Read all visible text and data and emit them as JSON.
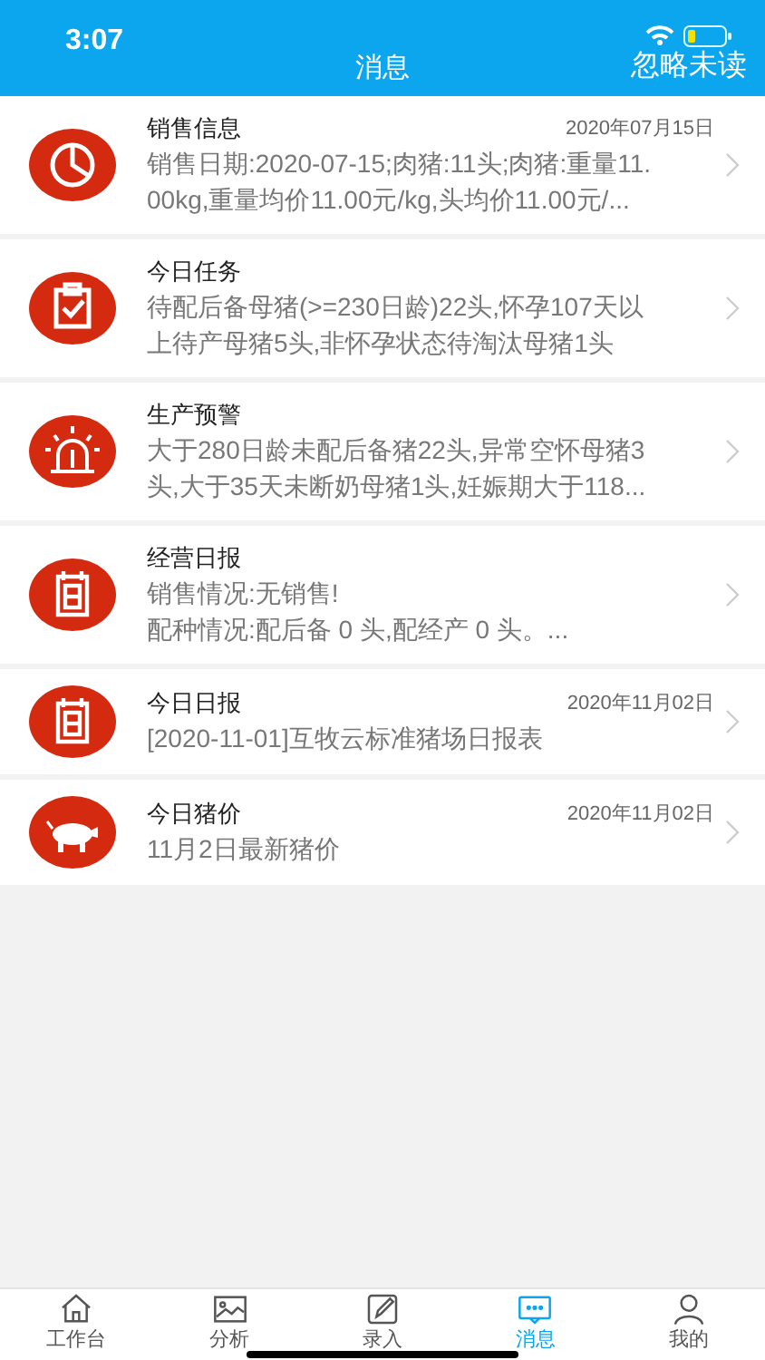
{
  "status_bar": {
    "time": "3:07"
  },
  "header": {
    "title": "消息",
    "action": "忽略未读"
  },
  "messages": [
    {
      "kind": "sales",
      "title": "销售信息",
      "date": "2020年07月15日",
      "lines": [
        "销售日期:2020-07-15;肉猪:11头;肉猪:重量11.",
        "00kg,重量均价11.00元/kg,头均价11.00元/..."
      ]
    },
    {
      "kind": "task",
      "title": "今日任务",
      "lines": [
        "待配后备母猪(>=230日龄)22头,怀孕107天以",
        "上待产母猪5头,非怀孕状态待淘汰母猪1头"
      ]
    },
    {
      "kind": "alert",
      "title": "生产预警",
      "lines": [
        "大于280日龄未配后备猪22头,异常空怀母猪3",
        "头,大于35天未断奶母猪1头,妊娠期大于118..."
      ]
    },
    {
      "kind": "report",
      "title": "经营日报",
      "lines": [
        "销售情况:无销售!",
        "配种情况:配后备 0 头,配经产 0 头。..."
      ]
    },
    {
      "kind": "report",
      "title": "今日日报",
      "date": "2020年11月02日",
      "lines": [
        "[2020-11-01]互牧云标准猪场日报表"
      ]
    },
    {
      "kind": "price",
      "title": "今日猪价",
      "date": "2020年11月02日",
      "lines": [
        "11月2日最新猪价"
      ]
    }
  ],
  "tabs": [
    {
      "kind": "home",
      "label": "工作台",
      "selected": false
    },
    {
      "kind": "image",
      "label": "分析",
      "selected": false
    },
    {
      "kind": "edit",
      "label": "录入",
      "selected": false
    },
    {
      "kind": "chat",
      "label": "消息",
      "selected": true
    },
    {
      "kind": "user",
      "label": "我的",
      "selected": false
    }
  ]
}
